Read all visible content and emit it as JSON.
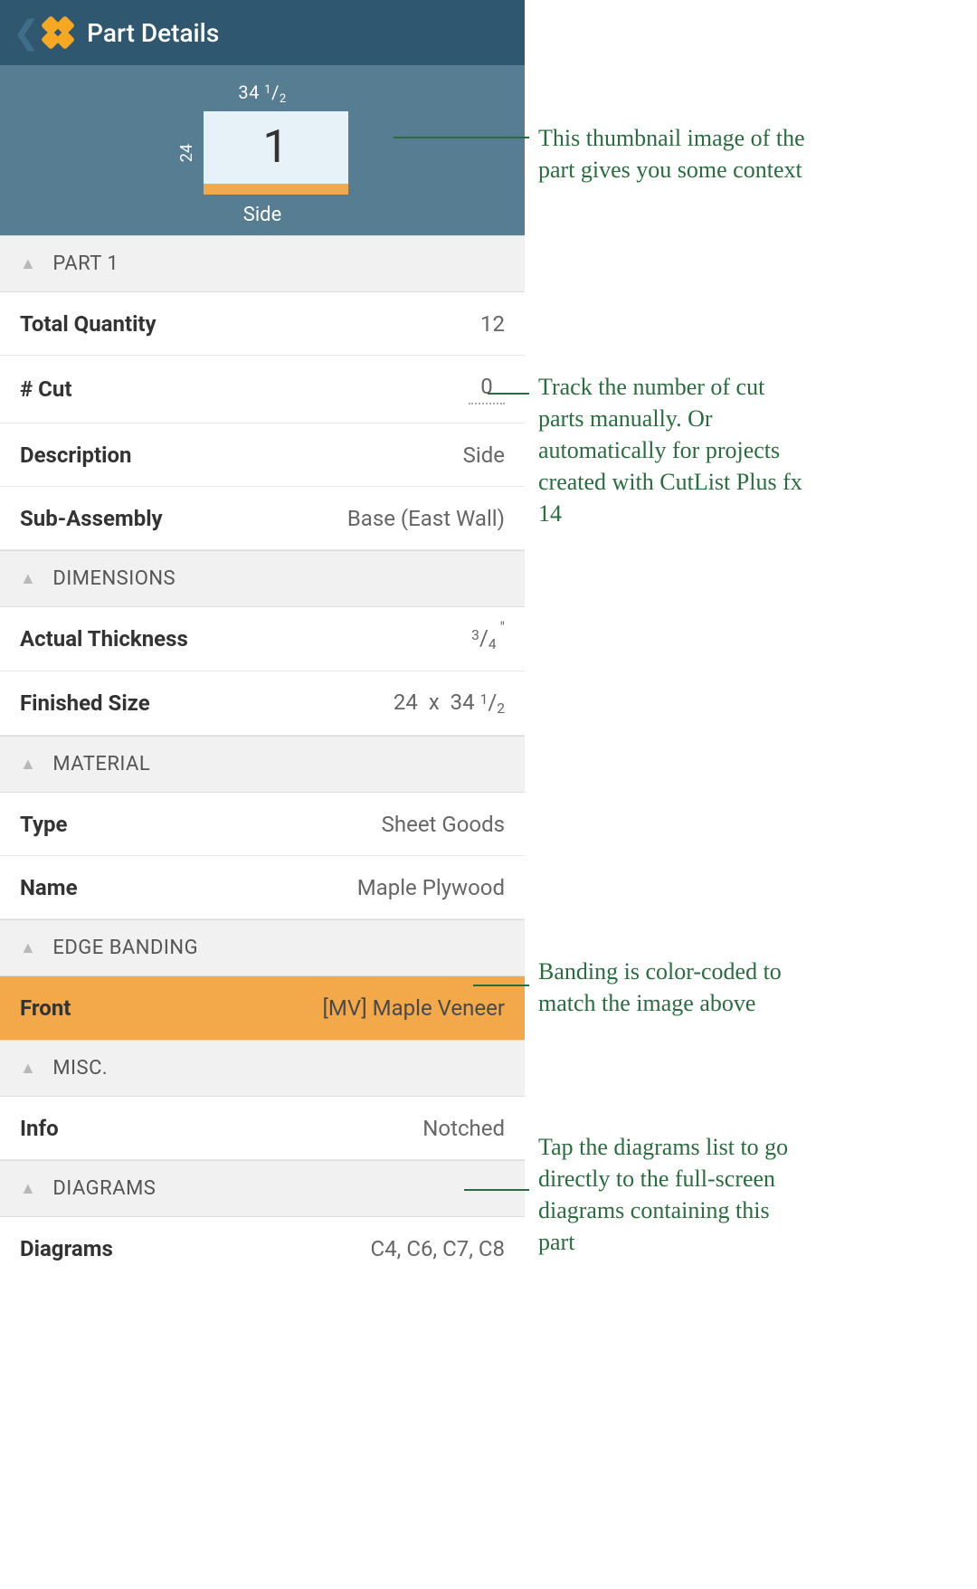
{
  "header": {
    "title": "Part Details"
  },
  "thumbnail": {
    "top_dim_int": "34",
    "top_dim_num": "1",
    "top_dim_den": "2",
    "left_dim": "24",
    "part_number": "1",
    "label": "Side"
  },
  "sections": {
    "part": {
      "title": "PART 1",
      "total_qty_label": "Total Quantity",
      "total_qty_value": "12",
      "cut_label": "# Cut",
      "cut_value": "0",
      "description_label": "Description",
      "description_value": "Side",
      "subassembly_label": "Sub-Assembly",
      "subassembly_value": "Base (East Wall)"
    },
    "dimensions": {
      "title": "DIMENSIONS",
      "thickness_label": "Actual Thickness",
      "thickness_num": "3",
      "thickness_den": "4",
      "finished_label": "Finished Size",
      "finished_w": "24",
      "finished_h_int": "34",
      "finished_h_num": "1",
      "finished_h_den": "2"
    },
    "material": {
      "title": "MATERIAL",
      "type_label": "Type",
      "type_value": "Sheet Goods",
      "name_label": "Name",
      "name_value": "Maple Plywood"
    },
    "edge_banding": {
      "title": "EDGE BANDING",
      "front_label": "Front",
      "front_value": "[MV] Maple Veneer"
    },
    "misc": {
      "title": "MISC.",
      "info_label": "Info",
      "info_value": "Notched"
    },
    "diagrams": {
      "title": "DIAGRAMS",
      "diagrams_label": "Diagrams",
      "diagrams_value": "C4, C6, C7, C8"
    }
  },
  "annotations": {
    "thumb": "This thumbnail image of the part gives you some context",
    "cut": "Track the number of cut parts manually. Or automatically for projects created with CutList Plus fx 14",
    "banding": "Banding is color-coded to match the image above",
    "diagrams": "Tap the diagrams list to go directly to the full-screen diagrams containing this part"
  }
}
